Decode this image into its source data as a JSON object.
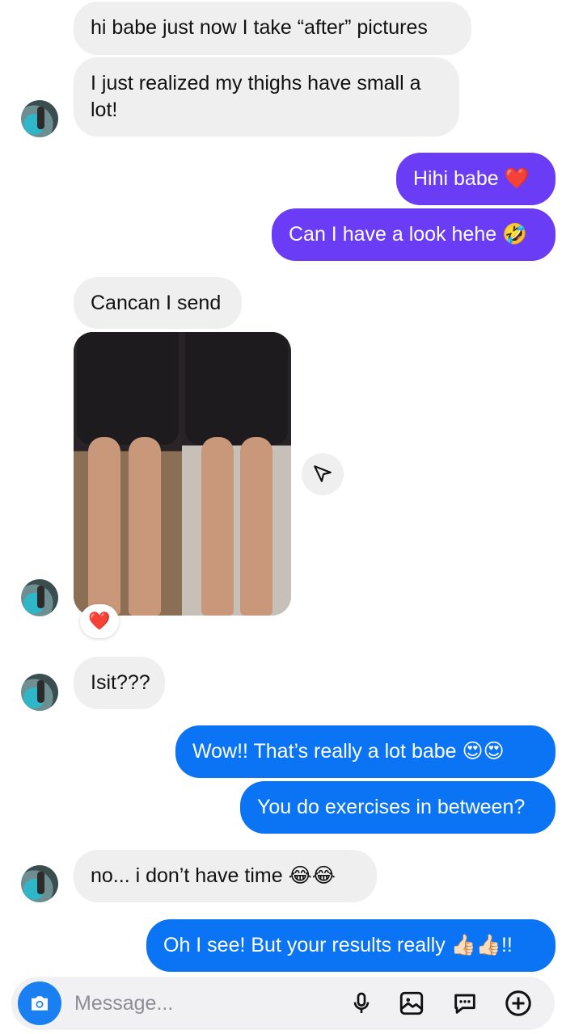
{
  "messages": [
    {
      "text": "hi babe just now I take “after” pictures"
    },
    {
      "text": "I just realized my thighs have small a lot!"
    },
    {
      "text": "Hihi babe ❤️"
    },
    {
      "text": "Can I have a look hehe 🤣"
    },
    {
      "text": "Cancan I send"
    },
    {
      "text": "Isit???"
    },
    {
      "text": "Wow!! That’s really a lot babe 😍😍"
    },
    {
      "text": "You do exercises in between?"
    },
    {
      "text": "no... i don’t have time 😂😂"
    },
    {
      "text": "Oh I see! But your results really 👍🏻👍🏻!!"
    }
  ],
  "reaction": {
    "emoji": "❤️"
  },
  "composer": {
    "placeholder": "Message..."
  },
  "colors": {
    "incoming": "#efefef",
    "outgoing_purple": "#6a3cf5",
    "outgoing_blue": "#0a74f5",
    "camera": "#1a80f2"
  },
  "icons": [
    "camera-icon",
    "send-icon",
    "microphone-icon",
    "gallery-icon",
    "sticker-icon",
    "plus-icon",
    "heart-icon"
  ]
}
